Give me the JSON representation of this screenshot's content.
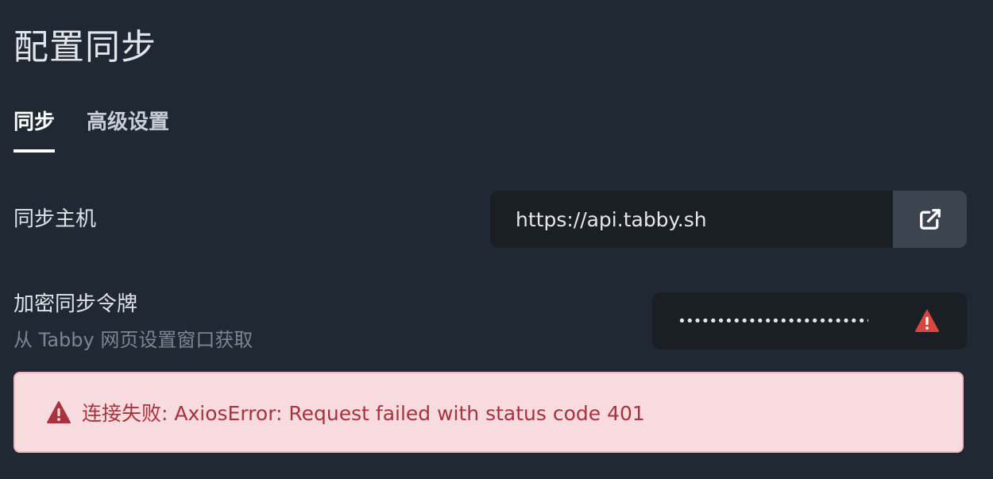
{
  "page": {
    "title": "配置同步"
  },
  "tabs": [
    {
      "label": "同步",
      "active": true
    },
    {
      "label": "高级设置",
      "active": false
    }
  ],
  "sync_host": {
    "label": "同步主机",
    "value": "https://api.tabby.sh",
    "open_icon": "external-link-icon"
  },
  "sync_token": {
    "label": "加密同步令牌",
    "sublabel": "从 Tabby 网页设置窗口获取",
    "masked_value": "••••••••••••••••••••••••••••••••",
    "status_icon": "warning-icon",
    "status_color": "#d9463e"
  },
  "alert": {
    "icon": "warning-icon",
    "message": "连接失败: AxiosError: Request failed with status code 401",
    "background": "#f8dbde",
    "text_color": "#a8323e"
  }
}
